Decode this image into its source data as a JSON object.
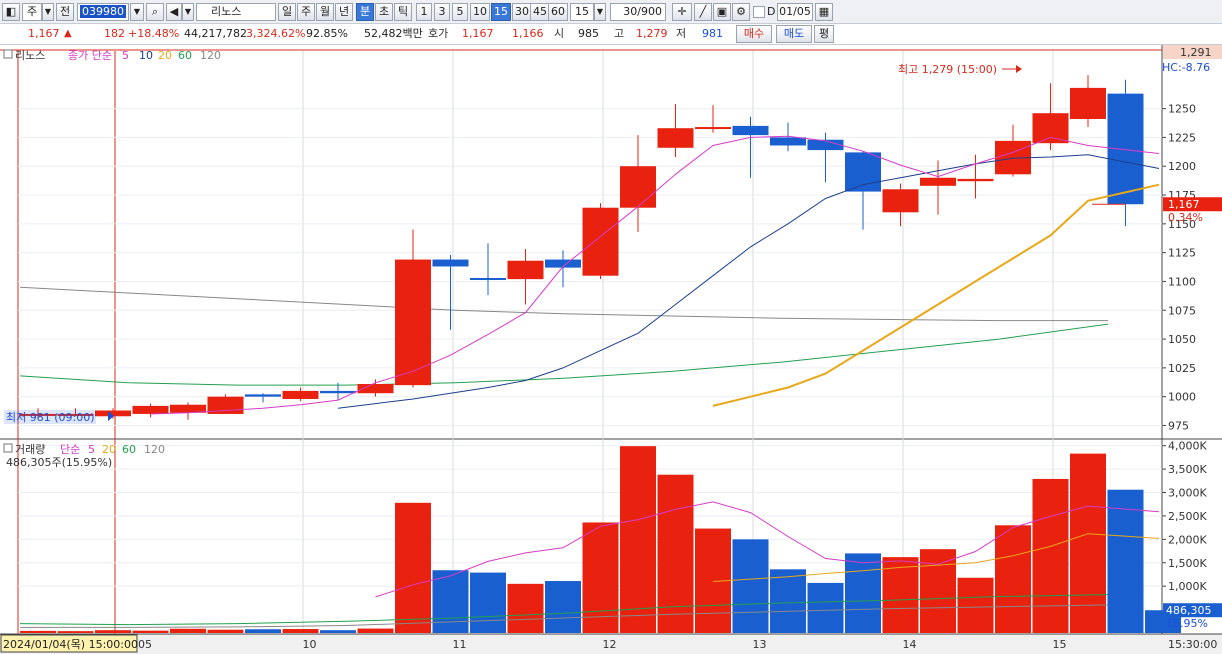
{
  "toolbar": {
    "period_type": "주",
    "prev_label": "전",
    "code": "039980",
    "stock_name": "리노스",
    "timeframes": [
      "일",
      "주",
      "월",
      "년",
      "분",
      "초",
      "틱"
    ],
    "active_timeframe": "분",
    "minutes": [
      "1",
      "3",
      "5",
      "10",
      "15",
      "30",
      "45",
      "60"
    ],
    "active_minute": "15",
    "minute_select": "15",
    "count": "30/900",
    "d_label": "D",
    "date_field": "01/05"
  },
  "quote": {
    "price": "1,167",
    "change": "182",
    "change_pct": "+18.48%",
    "volume": "44,217,782",
    "volume_pct": "3,324.62%",
    "ratio": "92.85%",
    "amount": "52,482백만",
    "hoga_label": "호가",
    "ask": "1,167",
    "bid": "1,166",
    "open_label": "시",
    "open": "985",
    "high_label": "고",
    "high": "1,279",
    "low_label": "저",
    "low": "981",
    "buy_label": "매수",
    "sell_label": "매도",
    "eval_label": "평"
  },
  "legend": {
    "price_name": "리노스",
    "price_ma_label": "종가 단순",
    "ma_periods": [
      "5",
      "10",
      "20",
      "60",
      "120"
    ],
    "volume_name": "거래량",
    "volume_ma_label": "단순",
    "volume_ma_periods": [
      "5",
      "20",
      "60",
      "120"
    ],
    "volume_current": "486,305주(15.95%)"
  },
  "colors": {
    "up": "#e8220e",
    "down": "#1a5fd0",
    "ma5": "#d63cc8",
    "ma10": "#1d3f8f",
    "ma20": "#e8a81a",
    "ma60": "#22a050",
    "ma120": "#888888"
  },
  "chart_data": [
    {
      "type": "candlestick",
      "title": "리노스",
      "ylim": [
        965,
        1300
      ],
      "yticks": [
        975,
        1000,
        1025,
        1050,
        1075,
        1100,
        1125,
        1150,
        1175,
        1200,
        1225,
        1250
      ],
      "candles": [
        {
          "o": 985,
          "h": 990,
          "l": 981,
          "c": 985
        },
        {
          "o": 985,
          "h": 990,
          "l": 983,
          "c": 985
        },
        {
          "o": 983,
          "h": 990,
          "l": 981,
          "c": 988
        },
        {
          "o": 985,
          "h": 994,
          "l": 982,
          "c": 992
        },
        {
          "o": 986,
          "h": 995,
          "l": 980,
          "c": 993
        },
        {
          "o": 985,
          "h": 1002,
          "l": 985,
          "c": 1000
        },
        {
          "o": 1002,
          "h": 1003,
          "l": 995,
          "c": 1000
        },
        {
          "o": 998,
          "h": 1008,
          "l": 996,
          "c": 1005
        },
        {
          "o": 1005,
          "h": 1012,
          "l": 997,
          "c": 1003
        },
        {
          "o": 1003,
          "h": 1015,
          "l": 1000,
          "c": 1011
        },
        {
          "o": 1010,
          "h": 1145,
          "l": 1008,
          "c": 1119
        },
        {
          "o": 1119,
          "h": 1123,
          "l": 1058,
          "c": 1113
        },
        {
          "o": 1103,
          "h": 1133,
          "l": 1088,
          "c": 1102
        },
        {
          "o": 1102,
          "h": 1128,
          "l": 1080,
          "c": 1118
        },
        {
          "o": 1119,
          "h": 1127,
          "l": 1095,
          "c": 1112
        },
        {
          "o": 1105,
          "h": 1168,
          "l": 1102,
          "c": 1164
        },
        {
          "o": 1164,
          "h": 1227,
          "l": 1143,
          "c": 1200
        },
        {
          "o": 1216,
          "h": 1254,
          "l": 1208,
          "c": 1233
        },
        {
          "o": 1233,
          "h": 1253,
          "l": 1229,
          "c": 1234
        },
        {
          "o": 1235,
          "h": 1243,
          "l": 1190,
          "c": 1227
        },
        {
          "o": 1225,
          "h": 1238,
          "l": 1213,
          "c": 1218
        },
        {
          "o": 1223,
          "h": 1229,
          "l": 1186,
          "c": 1214
        },
        {
          "o": 1212,
          "h": 1213,
          "l": 1145,
          "c": 1178
        },
        {
          "o": 1160,
          "h": 1185,
          "l": 1148,
          "c": 1180
        },
        {
          "o": 1183,
          "h": 1205,
          "l": 1158,
          "c": 1190
        },
        {
          "o": 1187,
          "h": 1210,
          "l": 1172,
          "c": 1189
        },
        {
          "o": 1193,
          "h": 1236,
          "l": 1191,
          "c": 1222
        },
        {
          "o": 1220,
          "h": 1272,
          "l": 1214,
          "c": 1246
        },
        {
          "o": 1241,
          "h": 1279,
          "l": 1234,
          "c": 1268
        },
        {
          "o": 1263,
          "h": 1275,
          "l": 1148,
          "c": 1167
        }
      ],
      "ma5": [
        null,
        null,
        null,
        null,
        985,
        986,
        988,
        990,
        993,
        997,
        1012,
        1022,
        1036,
        1054,
        1073,
        1113,
        1139,
        1165,
        1193,
        1218,
        1225,
        1226,
        1222,
        1213,
        1201,
        1191,
        1202,
        1212,
        1225,
        1218,
        1211
      ],
      "ma10": [
        null,
        null,
        null,
        null,
        null,
        null,
        null,
        null,
        null,
        990,
        994,
        998,
        1003,
        1008,
        1014,
        1025,
        1040,
        1055,
        1080,
        1105,
        1130,
        1150,
        1172,
        1184,
        1190,
        1196,
        1202,
        1207,
        1208,
        1210,
        1198
      ],
      "ma20": [
        null,
        null,
        null,
        null,
        null,
        null,
        null,
        null,
        null,
        null,
        null,
        null,
        null,
        null,
        null,
        null,
        null,
        null,
        null,
        992,
        1000,
        1008,
        1020,
        1040,
        1060,
        1080,
        1100,
        1120,
        1140,
        1170,
        1184
      ],
      "ma60_points": [
        1018,
        1012,
        1010,
        1010,
        1012,
        1016,
        1022,
        1030,
        1040,
        1050,
        1063
      ],
      "ma120_points": [
        1095,
        1090,
        1085,
        1080,
        1075,
        1072,
        1070,
        1068,
        1067,
        1066,
        1066
      ],
      "high_marker": "최고 1,279 (15:00)",
      "low_marker": "최저 981 (09:00)",
      "current_price_label": "1,167",
      "current_pct_label": "0.34%",
      "top_right_label": "1,291",
      "hc_label": "HC:-8.76"
    },
    {
      "type": "bar",
      "title": "거래량",
      "ylim": [
        0,
        4100000
      ],
      "yticks": [
        "1,000K",
        "1,500K",
        "2,000K",
        "2,500K",
        "3,000K",
        "3,500K",
        "4,000K"
      ],
      "yticks_values": [
        1000000,
        1500000,
        2000000,
        2500000,
        3000000,
        3500000,
        4000000
      ],
      "values": [
        45000,
        40000,
        60000,
        50000,
        90000,
        70000,
        80000,
        85000,
        60000,
        95000,
        2780000,
        1340000,
        1290000,
        1050000,
        1110000,
        2360000,
        3990000,
        3380000,
        2230000,
        2000000,
        1360000,
        1070000,
        1700000,
        1620000,
        1790000,
        1180000,
        2300000,
        3290000,
        3830000,
        3060000,
        486305
      ],
      "ma5": [
        null,
        null,
        null,
        null,
        null,
        null,
        null,
        null,
        null,
        null,
        770000,
        1030000,
        1220000,
        1530000,
        1710000,
        1820000,
        2280000,
        2420000,
        2640000,
        2800000,
        2570000,
        2060000,
        1590000,
        1500000,
        1540000,
        1470000,
        1740000,
        2250000,
        2490000,
        2710000,
        2590000
      ],
      "ma20": [
        null,
        null,
        null,
        null,
        null,
        null,
        null,
        null,
        null,
        null,
        null,
        null,
        null,
        null,
        null,
        null,
        null,
        null,
        null,
        1100000,
        1150000,
        1200000,
        1270000,
        1330000,
        1400000,
        1450000,
        1500000,
        1650000,
        1850000,
        2120000,
        2020000
      ],
      "ma60_points": [
        200000,
        180000,
        200000,
        250000,
        320000,
        420000,
        560000,
        640000,
        700000,
        780000,
        820000
      ],
      "ma120_points": [
        120000,
        120000,
        130000,
        160000,
        240000,
        320000,
        400000,
        460000,
        520000,
        560000,
        600000
      ],
      "current_label": "486,305",
      "current_pct": "15.95%"
    }
  ],
  "xaxis": {
    "labels": [
      {
        "bar": 0,
        "text": "05"
      },
      {
        "bar": 6.5,
        "text": "10"
      },
      {
        "bar": 10.5,
        "text": "11"
      },
      {
        "bar": 14.5,
        "text": "12"
      },
      {
        "bar": 18.5,
        "text": "13"
      },
      {
        "bar": 22.5,
        "text": "14"
      },
      {
        "bar": 26.5,
        "text": "15"
      }
    ],
    "cursor_date": "2024/01/04(목) 15:00:00",
    "right_time": "15:30:00"
  }
}
